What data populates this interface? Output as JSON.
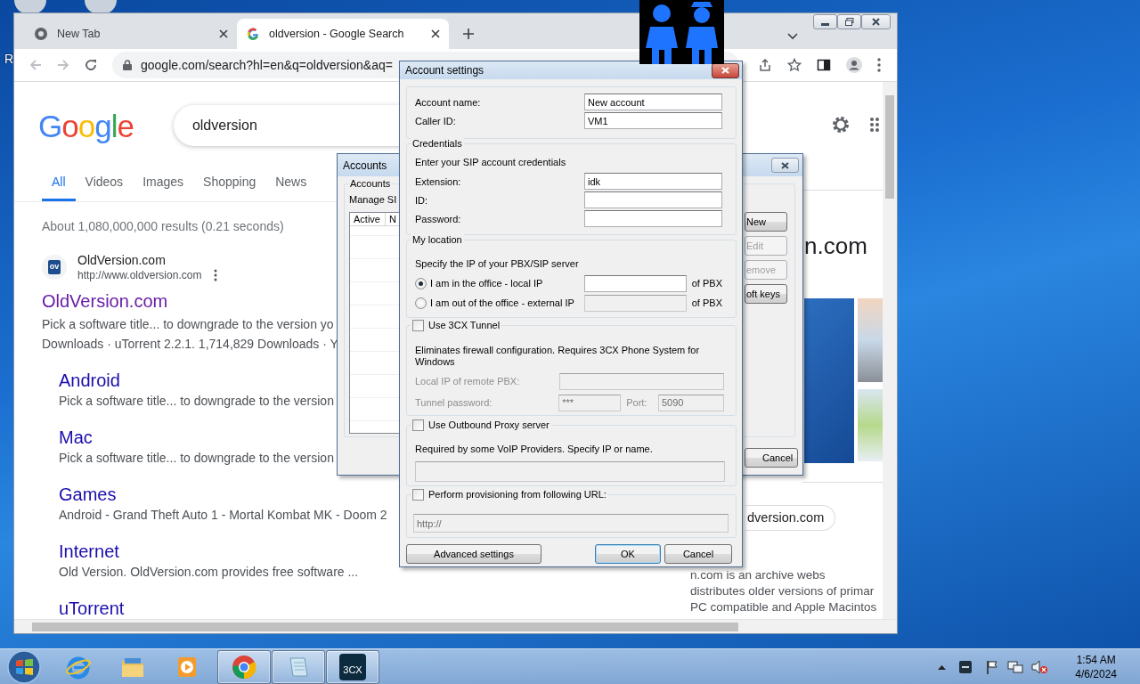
{
  "desktop": {
    "icon_label": "R"
  },
  "browser": {
    "tabs": [
      {
        "title": "New Tab",
        "selected": false
      },
      {
        "title": "oldversion - Google Search",
        "selected": true
      }
    ],
    "address": "google.com/search?hl=en&q=oldversion&aq=",
    "logo": "Google",
    "query": "oldversion",
    "search_tabs": [
      {
        "label": "All",
        "selected": true
      },
      {
        "label": "Videos",
        "selected": false
      },
      {
        "label": "Images",
        "selected": false
      },
      {
        "label": "Shopping",
        "selected": false
      },
      {
        "label": "News",
        "selected": false
      }
    ],
    "result_stats": "About 1,080,000,000 results (0.21 seconds)",
    "top_result": {
      "favicon": "ov",
      "site_name": "OldVersion.com",
      "site_url": "http://www.oldversion.com",
      "title": "OldVersion.com",
      "snippet": [
        "Pick a software title... to downgrade to the version yo",
        "Downloads · uTorrent 2.2.1. 1,714,829 Downloads · Y"
      ],
      "sitelinks": [
        {
          "title": "Android",
          "snippet": "Pick a software title... to downgrade to the version"
        },
        {
          "title": "Mac",
          "snippet": "Pick a software title... to downgrade to the version"
        },
        {
          "title": "Games",
          "snippet": "Android - Grand Theft Auto 1 - Mortal Kombat MK - Doom 2"
        },
        {
          "title": "Internet",
          "snippet": "Old Version. OldVersion.com provides free software ..."
        },
        {
          "title": "uTorrent"
        }
      ]
    },
    "side_panel": {
      "heading": "n.com",
      "chip": "dversion.com",
      "description": [
        "n.com is an archive webs",
        "distributes older versions of primar",
        "PC compatible and Apple Macintos"
      ]
    }
  },
  "accounts_window": {
    "title": "Accounts",
    "group": "Accounts",
    "intro": "Manage SI",
    "columns": [
      "Active",
      "N"
    ],
    "buttons": [
      {
        "label": "New",
        "disabled": false
      },
      {
        "label": "Edit",
        "disabled": true
      },
      {
        "label": "emove",
        "disabled": true
      },
      {
        "label": "oft keys",
        "disabled": false
      }
    ],
    "cancel": "Cancel"
  },
  "account_settings": {
    "title": "Account settings",
    "identity": [
      {
        "label": "Account name:",
        "value": "New account"
      },
      {
        "label": "Caller ID:",
        "value": "VM1"
      }
    ],
    "credentials": {
      "legend": "Credentials",
      "intro": "Enter your SIP account credentials",
      "fields": [
        {
          "label": "Extension:",
          "value": "idk"
        },
        {
          "label": "ID:"
        },
        {
          "label": "Password:"
        }
      ]
    },
    "location": {
      "legend": "My location",
      "intro": "Specify the IP of your PBX/SIP server",
      "options": [
        {
          "label": "I am in the office - local IP",
          "selected": true,
          "suffix": "of PBX"
        },
        {
          "label": "I am out of the office - external IP",
          "selected": false,
          "suffix": "of PBX"
        }
      ]
    },
    "tunnel": {
      "label": "Use 3CX Tunnel",
      "checked": false,
      "description": "Eliminates firewall configuration. Requires 3CX Phone System for Windows",
      "local_ip_label": "Local IP of remote PBX:",
      "password_label": "Tunnel password:",
      "password_value": "***",
      "port_label": "Port:",
      "port_value": "5090"
    },
    "proxy": {
      "label": "Use Outbound Proxy server",
      "checked": false,
      "description": "Required by some VoIP Providers. Specify IP or name."
    },
    "provisioning": {
      "label": "Perform provisioning from following URL:",
      "checked": false,
      "value": "http://"
    },
    "buttons": [
      {
        "label": "Advanced settings",
        "kind": "normal"
      },
      {
        "label": "OK",
        "kind": "default"
      },
      {
        "label": "Cancel",
        "kind": "normal"
      }
    ]
  },
  "taskbar": {
    "apps": [
      {
        "kind": "ie",
        "running": false
      },
      {
        "kind": "explorer",
        "running": false
      },
      {
        "kind": "media",
        "running": false
      },
      {
        "kind": "chrome",
        "running": true
      },
      {
        "kind": "notepad",
        "running": true
      },
      {
        "kind": "phone",
        "label": "3CX",
        "running": true
      }
    ],
    "time": "1:54 AM",
    "date": "4/6/2024"
  }
}
